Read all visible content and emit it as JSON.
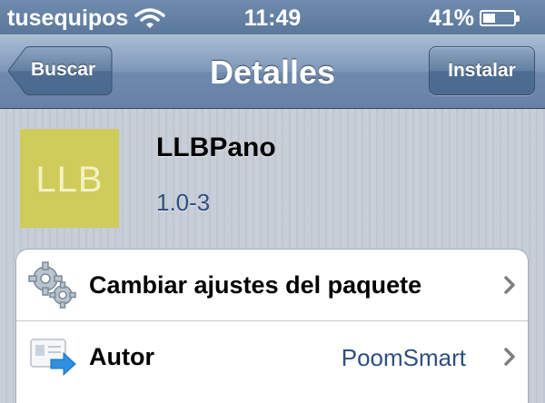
{
  "status_bar": {
    "carrier": "tusequipos",
    "time": "11:49",
    "battery_percent": "41%",
    "battery_level": 0.41,
    "wifi_icon": "wifi-icon",
    "battery_icon": "battery-icon"
  },
  "nav": {
    "title": "Detalles",
    "back_label": "Buscar",
    "install_label": "Instalar"
  },
  "package": {
    "icon_text": "LLB",
    "icon_color": "#cfcc5c",
    "name": "LLBPano",
    "version": "1.0-3"
  },
  "rows": [
    {
      "label": "Cambiar ajustes del paquete",
      "value": "",
      "icon": "gears-icon"
    },
    {
      "label": "Autor",
      "value": "PoomSmart",
      "icon": "contact-card-icon"
    }
  ],
  "colors": {
    "nav_bar": "#7d97b8",
    "link_blue": "#2c4f80"
  }
}
